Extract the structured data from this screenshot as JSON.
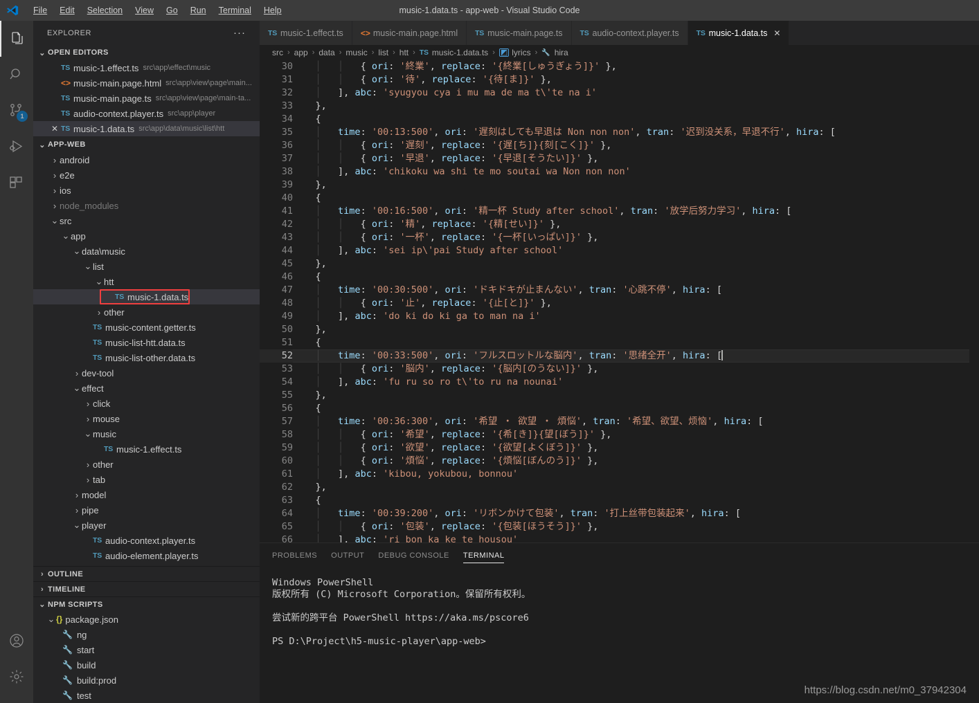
{
  "window": {
    "title": "music-1.data.ts - app-web - Visual Studio Code",
    "menus": [
      "File",
      "Edit",
      "Selection",
      "View",
      "Go",
      "Run",
      "Terminal",
      "Help"
    ]
  },
  "activitybar": {
    "items": [
      {
        "name": "explorer",
        "icon": "files-icon",
        "active": true,
        "badge": ""
      },
      {
        "name": "search",
        "icon": "search-icon",
        "active": false,
        "badge": ""
      },
      {
        "name": "source-control",
        "icon": "source-control-icon",
        "active": false,
        "badge": "1"
      },
      {
        "name": "run-and-debug",
        "icon": "run-debug-icon",
        "active": false,
        "badge": ""
      },
      {
        "name": "extensions",
        "icon": "extensions-icon",
        "active": false,
        "badge": ""
      }
    ],
    "bottom": [
      {
        "name": "accounts",
        "icon": "account-icon"
      },
      {
        "name": "manage",
        "icon": "gear-icon"
      }
    ]
  },
  "sidebar": {
    "title": "EXPLORER",
    "more_actions": "···",
    "open_editors": {
      "label": "OPEN EDITORS",
      "items": [
        {
          "icon": "ts",
          "name": "music-1.effect.ts",
          "path": "src\\app\\effect\\music",
          "active": false,
          "closable": false
        },
        {
          "icon": "html",
          "name": "music-main.page.html",
          "path": "src\\app\\view\\page\\main...",
          "active": false,
          "closable": false
        },
        {
          "icon": "ts",
          "name": "music-main.page.ts",
          "path": "src\\app\\view\\page\\main-ta...",
          "active": false,
          "closable": false
        },
        {
          "icon": "ts",
          "name": "audio-context.player.ts",
          "path": "src\\app\\player",
          "active": false,
          "closable": false
        },
        {
          "icon": "ts",
          "name": "music-1.data.ts",
          "path": "src\\app\\data\\music\\list\\htt",
          "active": true,
          "closable": true
        }
      ]
    },
    "workspace": {
      "label": "APP-WEB",
      "tree": [
        {
          "depth": 1,
          "kind": "folder",
          "state": "collapsed",
          "name": "android",
          "dim": false
        },
        {
          "depth": 1,
          "kind": "folder",
          "state": "collapsed",
          "name": "e2e",
          "dim": false
        },
        {
          "depth": 1,
          "kind": "folder",
          "state": "collapsed",
          "name": "ios",
          "dim": false
        },
        {
          "depth": 1,
          "kind": "folder",
          "state": "collapsed",
          "name": "node_modules",
          "dim": true
        },
        {
          "depth": 1,
          "kind": "folder",
          "state": "expanded",
          "name": "src",
          "dim": false
        },
        {
          "depth": 2,
          "kind": "folder",
          "state": "expanded",
          "name": "app",
          "dim": false
        },
        {
          "depth": 3,
          "kind": "folder",
          "state": "expanded",
          "name": "data\\music",
          "dim": false
        },
        {
          "depth": 4,
          "kind": "folder",
          "state": "expanded",
          "name": "list",
          "dim": false
        },
        {
          "depth": 5,
          "kind": "folder",
          "state": "expanded",
          "name": "htt",
          "dim": false
        },
        {
          "depth": 6,
          "kind": "ts",
          "state": "",
          "name": "music-1.data.ts",
          "dim": false,
          "selected": true,
          "highlighted": true
        },
        {
          "depth": 5,
          "kind": "folder",
          "state": "collapsed",
          "name": "other",
          "dim": false
        },
        {
          "depth": 4,
          "kind": "ts",
          "state": "",
          "name": "music-content.getter.ts",
          "dim": false
        },
        {
          "depth": 4,
          "kind": "ts",
          "state": "",
          "name": "music-list-htt.data.ts",
          "dim": false
        },
        {
          "depth": 4,
          "kind": "ts",
          "state": "",
          "name": "music-list-other.data.ts",
          "dim": false
        },
        {
          "depth": 3,
          "kind": "folder",
          "state": "collapsed",
          "name": "dev-tool",
          "dim": false
        },
        {
          "depth": 3,
          "kind": "folder",
          "state": "expanded",
          "name": "effect",
          "dim": false
        },
        {
          "depth": 4,
          "kind": "folder",
          "state": "collapsed",
          "name": "click",
          "dim": false
        },
        {
          "depth": 4,
          "kind": "folder",
          "state": "collapsed",
          "name": "mouse",
          "dim": false
        },
        {
          "depth": 4,
          "kind": "folder",
          "state": "expanded",
          "name": "music",
          "dim": false
        },
        {
          "depth": 5,
          "kind": "ts",
          "state": "",
          "name": "music-1.effect.ts",
          "dim": false
        },
        {
          "depth": 4,
          "kind": "folder",
          "state": "collapsed",
          "name": "other",
          "dim": false
        },
        {
          "depth": 4,
          "kind": "folder",
          "state": "collapsed",
          "name": "tab",
          "dim": false
        },
        {
          "depth": 3,
          "kind": "folder",
          "state": "collapsed",
          "name": "model",
          "dim": false
        },
        {
          "depth": 3,
          "kind": "folder",
          "state": "collapsed",
          "name": "pipe",
          "dim": false
        },
        {
          "depth": 3,
          "kind": "folder",
          "state": "expanded",
          "name": "player",
          "dim": false
        },
        {
          "depth": 4,
          "kind": "ts",
          "state": "",
          "name": "audio-context.player.ts",
          "dim": false
        },
        {
          "depth": 4,
          "kind": "ts",
          "state": "",
          "name": "audio-element.player.ts",
          "dim": false
        }
      ]
    },
    "outline": {
      "label": "OUTLINE",
      "state": "collapsed"
    },
    "timeline": {
      "label": "TIMELINE",
      "state": "collapsed"
    },
    "npm_scripts": {
      "label": "NPM SCRIPTS",
      "state": "expanded",
      "package": "package.json",
      "scripts": [
        "ng",
        "start",
        "build",
        "build:prod",
        "test"
      ]
    }
  },
  "editor": {
    "tabs": [
      {
        "icon": "ts",
        "label": "music-1.effect.ts",
        "active": false,
        "closable": false
      },
      {
        "icon": "html",
        "label": "music-main.page.html",
        "active": false,
        "closable": false
      },
      {
        "icon": "ts",
        "label": "music-main.page.ts",
        "active": false,
        "closable": false
      },
      {
        "icon": "ts",
        "label": "audio-context.player.ts",
        "active": false,
        "closable": false
      },
      {
        "icon": "ts",
        "label": "music-1.data.ts",
        "active": true,
        "closable": true
      }
    ],
    "breadcrumbs": [
      {
        "label": "src",
        "icon": ""
      },
      {
        "label": "app",
        "icon": ""
      },
      {
        "label": "data",
        "icon": ""
      },
      {
        "label": "music",
        "icon": ""
      },
      {
        "label": "list",
        "icon": ""
      },
      {
        "label": "htt",
        "icon": ""
      },
      {
        "label": "music-1.data.ts",
        "icon": "ts"
      },
      {
        "label": "lyrics",
        "icon": "symbol-array"
      },
      {
        "label": "hira",
        "icon": "symbol-property"
      }
    ],
    "first_line_number": 30,
    "current_line": 52,
    "lines": [
      {
        "n": 30,
        "text": "            { ori: '終業', replace: '{終業[しゅうぎょう]}' },"
      },
      {
        "n": 31,
        "text": "            { ori: '待', replace: '{待[ま]}' },"
      },
      {
        "n": 32,
        "text": "        ], abc: 'syugyou cya i mu ma de ma t\\'te na i'"
      },
      {
        "n": 33,
        "text": "    },"
      },
      {
        "n": 34,
        "text": "    {"
      },
      {
        "n": 35,
        "text": "        time: '00:13:500', ori: '遅刻はしても早退は Non non non', tran: '迟到没关系，早退不行', hira: ["
      },
      {
        "n": 36,
        "text": "            { ori: '遅刻', replace: '{遅[ち]}{刻[こく]}' },"
      },
      {
        "n": 37,
        "text": "            { ori: '早退', replace: '{早退[そうたい]}' },"
      },
      {
        "n": 38,
        "text": "        ], abc: 'chikoku wa shi te mo soutai wa Non non non'"
      },
      {
        "n": 39,
        "text": "    },"
      },
      {
        "n": 40,
        "text": "    {"
      },
      {
        "n": 41,
        "text": "        time: '00:16:500', ori: '精一杯 Study after school', tran: '放学后努力学习', hira: ["
      },
      {
        "n": 42,
        "text": "            { ori: '精', replace: '{精[せい]}' },"
      },
      {
        "n": 43,
        "text": "            { ori: '一杯', replace: '{一杯[いっぱい]}' },"
      },
      {
        "n": 44,
        "text": "        ], abc: 'sei ip\\'pai Study after school'"
      },
      {
        "n": 45,
        "text": "    },"
      },
      {
        "n": 46,
        "text": "    {"
      },
      {
        "n": 47,
        "text": "        time: '00:30:500', ori: 'ドキドキが止まんない', tran: '心跳不停', hira: ["
      },
      {
        "n": 48,
        "text": "            { ori: '止', replace: '{止[と]}' },"
      },
      {
        "n": 49,
        "text": "        ], abc: 'do ki do ki ga to man na i'"
      },
      {
        "n": 50,
        "text": "    },"
      },
      {
        "n": 51,
        "text": "    {"
      },
      {
        "n": 52,
        "text": "        time: '00:33:500', ori: 'フルスロットルな脳内', tran: '思绪全开', hira: ["
      },
      {
        "n": 53,
        "text": "            { ori: '脳内', replace: '{脳内[のうない]}' },"
      },
      {
        "n": 54,
        "text": "        ], abc: 'fu ru so ro t\\'to ru na nounai'"
      },
      {
        "n": 55,
        "text": "    },"
      },
      {
        "n": 56,
        "text": "    {"
      },
      {
        "n": 57,
        "text": "        time: '00:36:300', ori: '希望 ・ 欲望 ・ 煩悩', tran: '希望、欲望、烦恼', hira: ["
      },
      {
        "n": 58,
        "text": "            { ori: '希望', replace: '{希[き]}{望[ぼう]}' },"
      },
      {
        "n": 59,
        "text": "            { ori: '欲望', replace: '{欲望[よくぼう]}' },"
      },
      {
        "n": 60,
        "text": "            { ori: '煩悩', replace: '{煩悩[ぼんのう]}' },"
      },
      {
        "n": 61,
        "text": "        ], abc: 'kibou, yokubou, bonnou'"
      },
      {
        "n": 62,
        "text": "    },"
      },
      {
        "n": 63,
        "text": "    {"
      },
      {
        "n": 64,
        "text": "        time: '00:39:200', ori: 'リボンかけて包装', tran: '打上丝带包装起来', hira: ["
      },
      {
        "n": 65,
        "text": "            { ori: '包装', replace: '{包装[ほうそう]}' },"
      },
      {
        "n": 66,
        "text": "        ], abc: 'ri bon ka ke te housou'"
      }
    ]
  },
  "panel": {
    "tabs": [
      "PROBLEMS",
      "OUTPUT",
      "DEBUG CONSOLE",
      "TERMINAL"
    ],
    "active_tab": "TERMINAL",
    "terminal_lines": [
      "Windows PowerShell",
      "版权所有 (C) Microsoft Corporation。保留所有权利。",
      "",
      "尝试新的跨平台 PowerShell https://aka.ms/pscore6",
      "",
      "PS D:\\Project\\h5-music-player\\app-web>"
    ]
  },
  "watermark": "https://blog.csdn.net/m0_37942304",
  "colors": {
    "accent": "#007acc",
    "highlight_box": "#ef3f3f",
    "editor_bg": "#1e1e1e",
    "sidebar_bg": "#252526",
    "activitybar_bg": "#333333",
    "titlebar_bg": "#3c3c3c",
    "string": "#ce9178",
    "property": "#9cdcfe",
    "ts_icon": "#519aba",
    "html_icon": "#e37933"
  }
}
